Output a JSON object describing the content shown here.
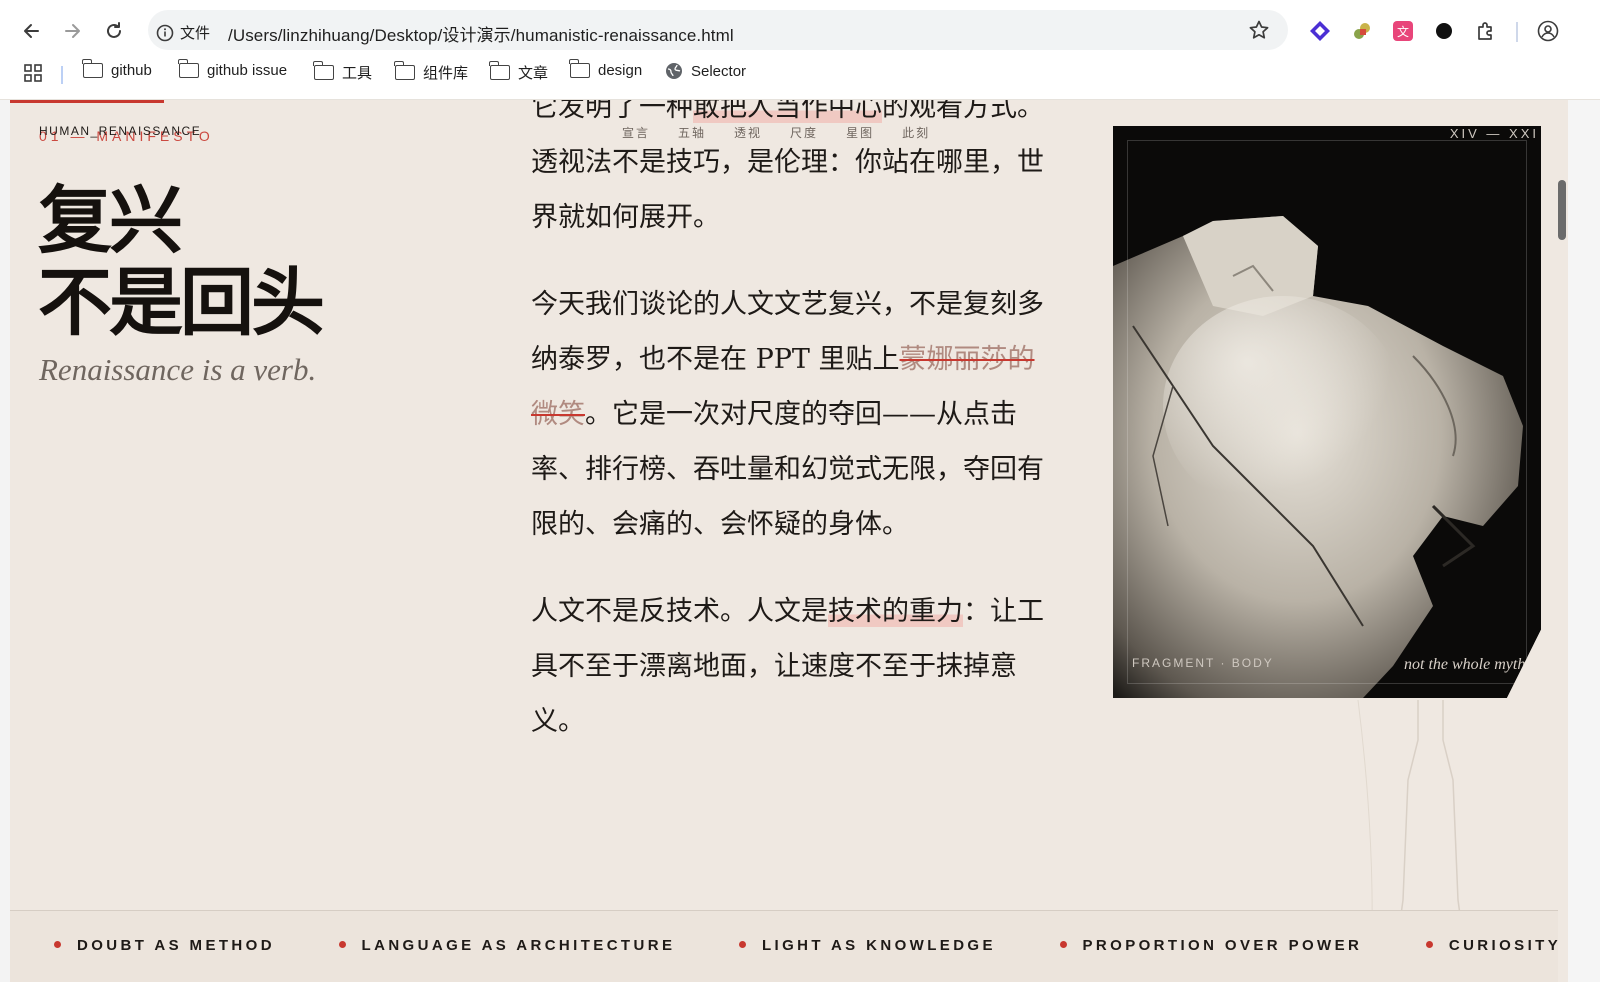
{
  "browser": {
    "info_label": "文件",
    "url": "/Users/linzhihuang/Desktop/设计演示/humanistic-renaissance.html",
    "bookmarks": [
      {
        "label": "github",
        "icon": "folder-icon"
      },
      {
        "label": "github issue",
        "icon": "folder-icon"
      },
      {
        "label": "工具",
        "icon": "folder-icon"
      },
      {
        "label": "组件库",
        "icon": "folder-icon"
      },
      {
        "label": "文章",
        "icon": "folder-icon"
      },
      {
        "label": "design",
        "icon": "folder-icon"
      },
      {
        "label": "Selector",
        "icon": "globe-icon"
      }
    ]
  },
  "page": {
    "eyebrow": "HUMAN_RENAISSANCE",
    "eyebrow_overlap": "01 — MANIFESTO",
    "title_line1": "复兴",
    "title_line2": "不是回头",
    "subtitle": "Renaissance is a verb.",
    "chapter_nav": [
      "宣言",
      "五轴",
      "透视",
      "尺度",
      "星图",
      "此刻"
    ],
    "article": {
      "p1_a": "它发明了一种",
      "p1_hl": "敢把人当作中心",
      "p1_b": "的观看方式。透视法不是技巧，是伦理：你站在哪里，世界就如何展开。",
      "p2_a": "今天我们谈论的人文文艺复兴，不是复刻多纳泰罗，也不是在 PPT 里贴上",
      "p2_strike": "蒙娜丽莎的微笑",
      "p2_b": "。它是一次对尺度的夺回——从点击率、排行榜、吞吐量和幻觉式无限，夺回有限的、会痛的、会怀疑的身体。",
      "p3_a": "人文不是反技术。人文是",
      "p3_hl": "技术的重力",
      "p3_b": "：让工具不至于漂离地面，让速度不至于抹掉意义。"
    },
    "figure": {
      "era": "XIV — XXI",
      "caption": "FRAGMENT · BODY",
      "quote": "not the whole myth"
    },
    "marquee": [
      "DOUBT AS METHOD",
      "LANGUAGE AS ARCHITECTURE",
      "LIGHT AS KNOWLEDGE",
      "PROPORTION OVER POWER",
      "CURIOSITY"
    ]
  },
  "colors": {
    "accent": "#c8382f",
    "paper": "#efe8e1",
    "ink": "#1e1a17"
  }
}
